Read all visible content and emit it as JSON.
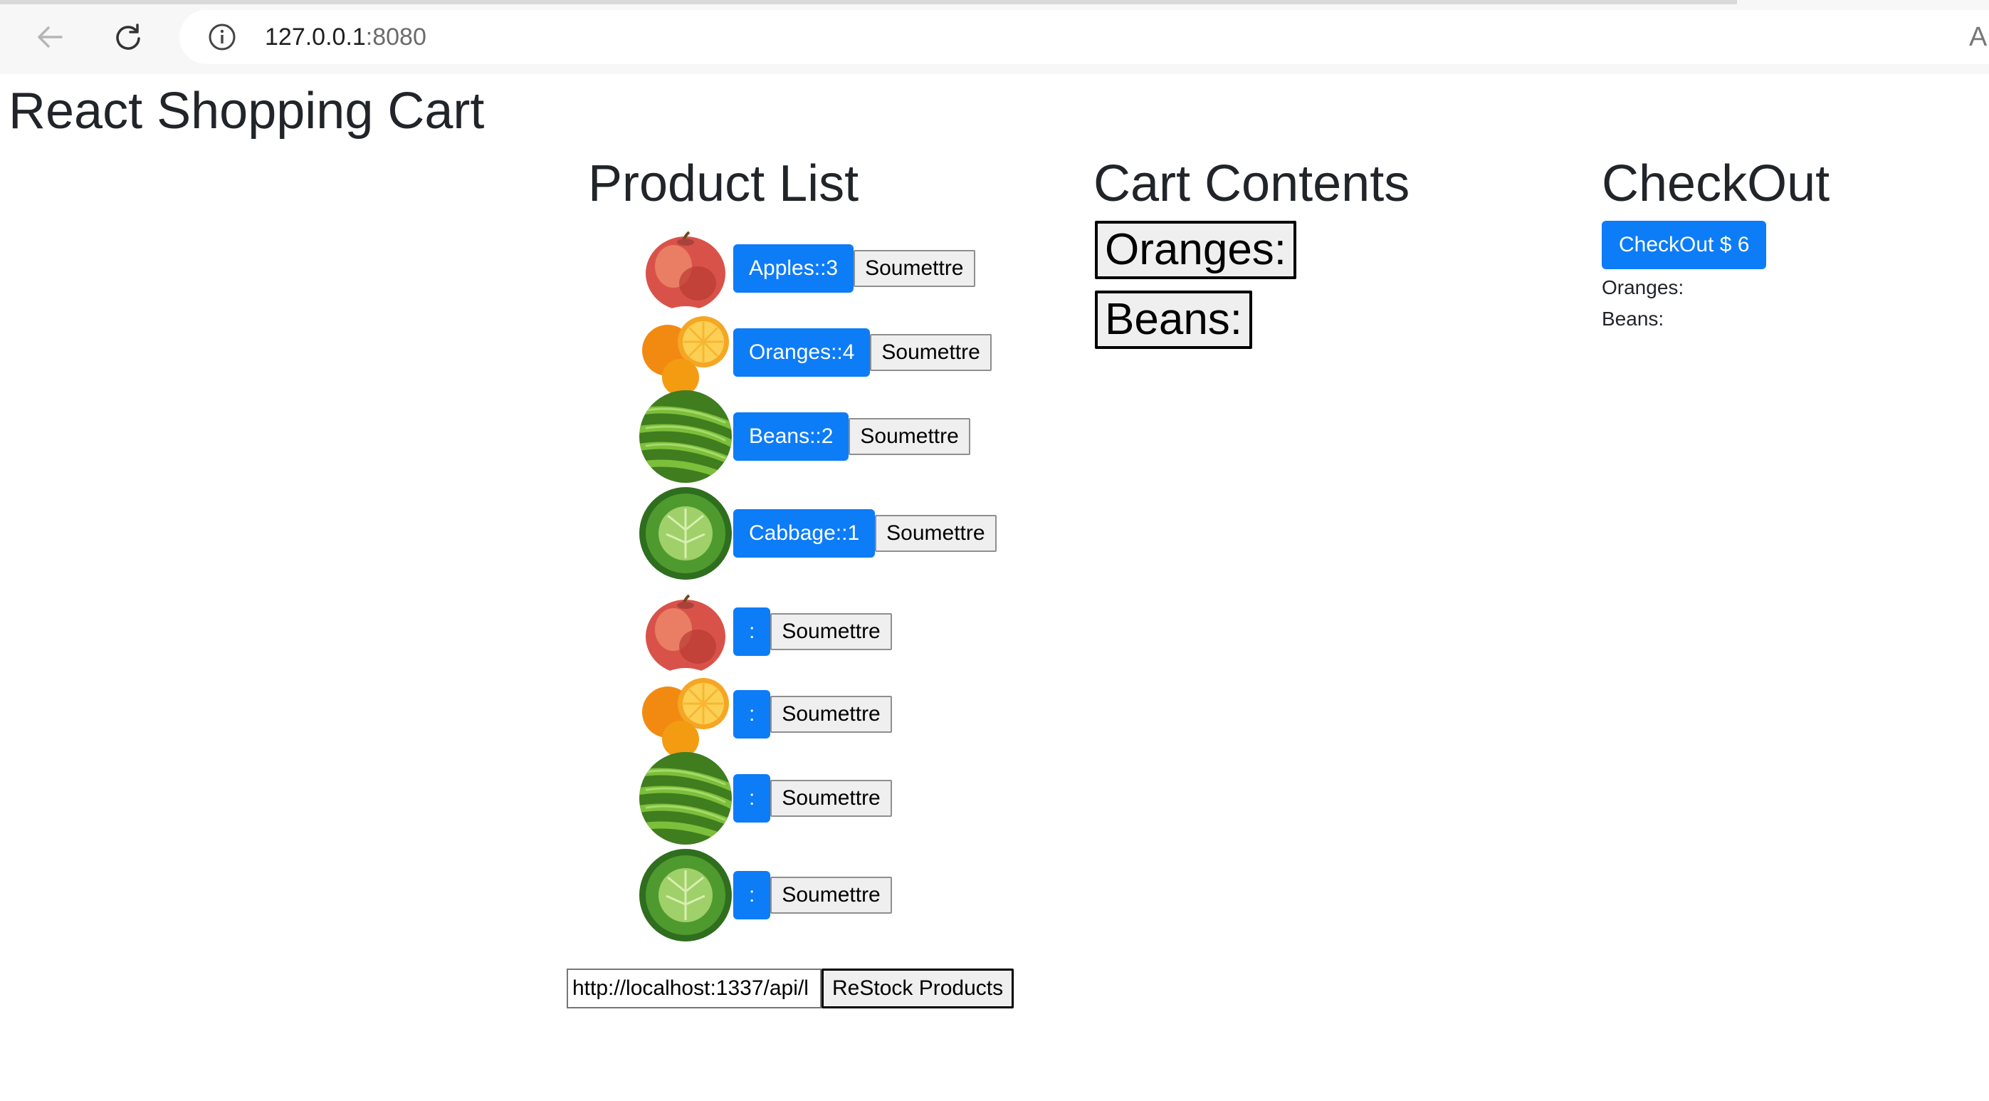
{
  "browser": {
    "url_host": "127.0.0.1",
    "url_port": ":8080",
    "edge_glyph": "A"
  },
  "page": {
    "title": "React Shopping Cart"
  },
  "product_list": {
    "heading": "Product List",
    "items": [
      {
        "label": "Apples::3",
        "image": "apple",
        "submit_label": "Soumettre"
      },
      {
        "label": "Oranges::4",
        "image": "orange",
        "submit_label": "Soumettre"
      },
      {
        "label": "Beans::2",
        "image": "beans",
        "submit_label": "Soumettre"
      },
      {
        "label": "Cabbage::1",
        "image": "cabbage",
        "submit_label": "Soumettre"
      },
      {
        "label": ":",
        "image": "apple",
        "submit_label": "Soumettre"
      },
      {
        "label": ":",
        "image": "orange",
        "submit_label": "Soumettre"
      },
      {
        "label": ":",
        "image": "beans",
        "submit_label": "Soumettre"
      },
      {
        "label": ":",
        "image": "cabbage",
        "submit_label": "Soumettre"
      }
    ],
    "restock": {
      "url_value": "http://localhost:1337/api/l",
      "button_label": "ReStock Products"
    }
  },
  "cart": {
    "heading": "Cart Contents",
    "items": [
      "Oranges:",
      "Beans:"
    ]
  },
  "checkout": {
    "heading": "CheckOut",
    "button_label": "CheckOut $ 6",
    "lines": [
      "Oranges:",
      "Beans:"
    ]
  },
  "colors": {
    "primary": "#0d7cf7",
    "text": "#212529"
  }
}
